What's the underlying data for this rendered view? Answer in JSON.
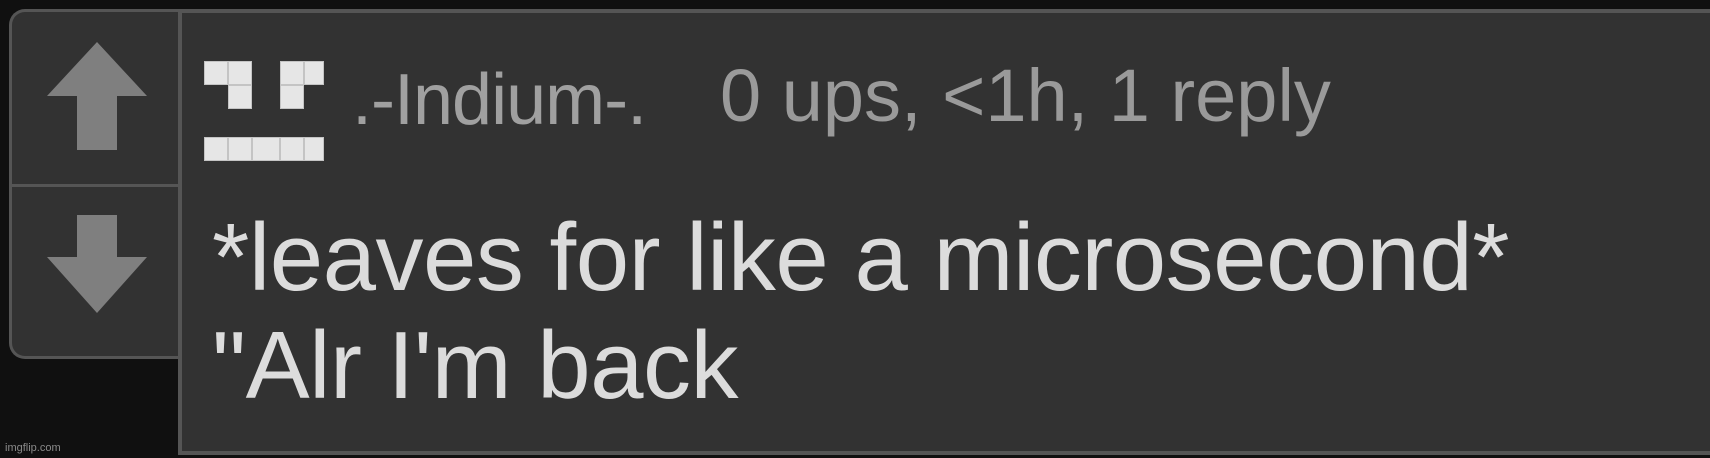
{
  "vote": {
    "upvote_icon": "up-arrow-icon",
    "downvote_icon": "down-arrow-icon"
  },
  "comment": {
    "username": ".-Indium-.",
    "meta": "0 ups, <1h, 1 reply",
    "lines": [
      "*leaves for like a microsecond*",
      "\"Alr I'm back"
    ]
  },
  "watermark": "imgflip.com",
  "colors": {
    "panel": "#323232",
    "border": "#555555",
    "arrow": "#7f7f7f",
    "text": "#dcdcdc",
    "meta_text": "#9a9a9a"
  }
}
